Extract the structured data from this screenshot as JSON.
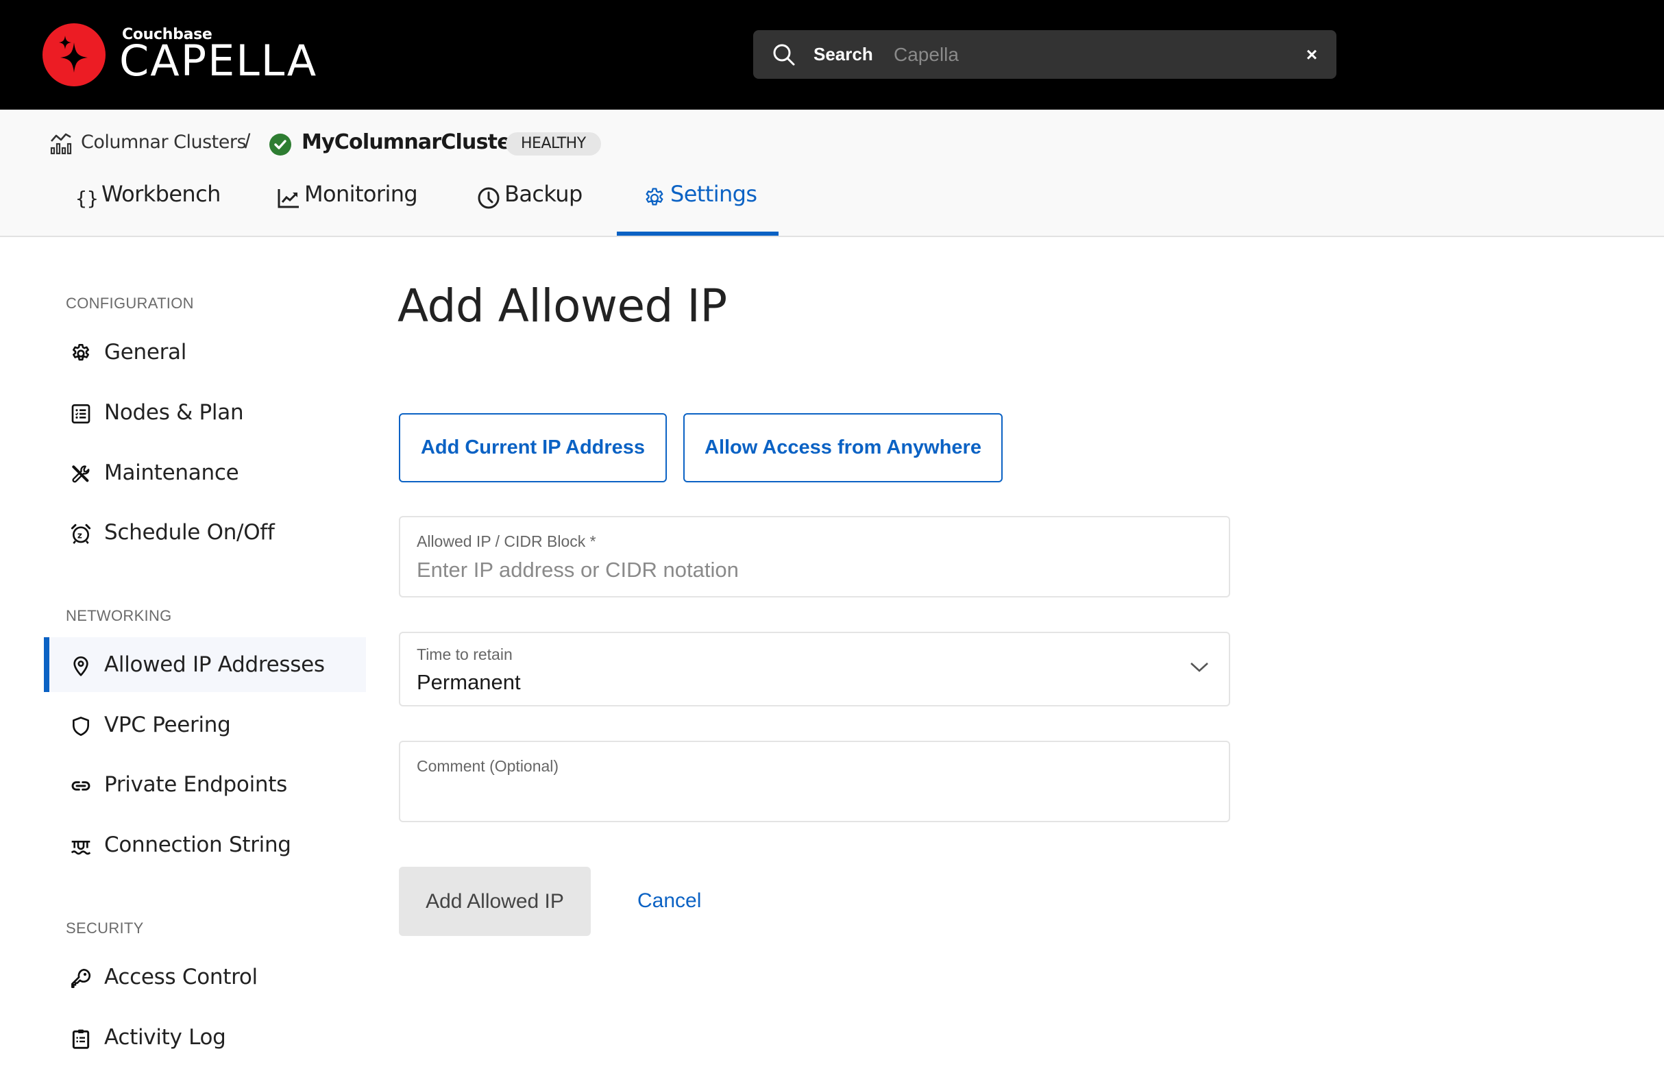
{
  "header": {
    "brand_small": "Couchbase",
    "brand_big": "CAPELLA",
    "search": {
      "label": "Search",
      "placeholder": "Capella",
      "clear_label": "×"
    }
  },
  "breadcrumb": {
    "parent": "Columnar Clusters",
    "separator": "/",
    "current": "MyColumnarCluster",
    "status_badge": "HEALTHY",
    "status_color": "#2e7d32"
  },
  "tabs": [
    {
      "label": "Workbench",
      "icon": "braces-icon",
      "active": false
    },
    {
      "label": "Monitoring",
      "icon": "chart-line-icon",
      "active": false
    },
    {
      "label": "Backup",
      "icon": "clock-icon",
      "active": false
    },
    {
      "label": "Settings",
      "icon": "gear-icon",
      "active": true
    }
  ],
  "sidebar": {
    "sections": [
      {
        "title": "CONFIGURATION",
        "items": [
          {
            "label": "General",
            "icon": "gear-icon"
          },
          {
            "label": "Nodes & Plan",
            "icon": "checklist-icon"
          },
          {
            "label": "Maintenance",
            "icon": "tools-icon"
          },
          {
            "label": "Schedule On/Off",
            "icon": "alarm-clock-icon"
          }
        ]
      },
      {
        "title": "NETWORKING",
        "items": [
          {
            "label": "Allowed IP Addresses",
            "icon": "map-pin-icon",
            "active": true
          },
          {
            "label": "VPC Peering",
            "icon": "shield-icon"
          },
          {
            "label": "Private Endpoints",
            "icon": "link-icon"
          },
          {
            "label": "Connection String",
            "icon": "connection-icon"
          }
        ]
      },
      {
        "title": "SECURITY",
        "items": [
          {
            "label": "Access Control",
            "icon": "key-icon"
          },
          {
            "label": "Activity Log",
            "icon": "clipboard-list-icon"
          }
        ]
      }
    ]
  },
  "main": {
    "title": "Add Allowed IP",
    "quick_actions": {
      "add_current": "Add Current IP Address",
      "allow_anywhere": "Allow Access from Anywhere"
    },
    "form": {
      "ip_field": {
        "label": "Allowed IP / CIDR Block *",
        "placeholder": "Enter IP address or CIDR notation",
        "value": ""
      },
      "retain_field": {
        "label": "Time to retain",
        "value": "Permanent"
      },
      "comment_field": {
        "label": "Comment (Optional)",
        "value": ""
      }
    },
    "actions": {
      "submit": "Add Allowed IP",
      "cancel": "Cancel"
    }
  },
  "colors": {
    "accent": "#0b62c4",
    "brand_red": "#ec1c24",
    "header_bg": "#000000",
    "healthy_green": "#2e7d32"
  }
}
